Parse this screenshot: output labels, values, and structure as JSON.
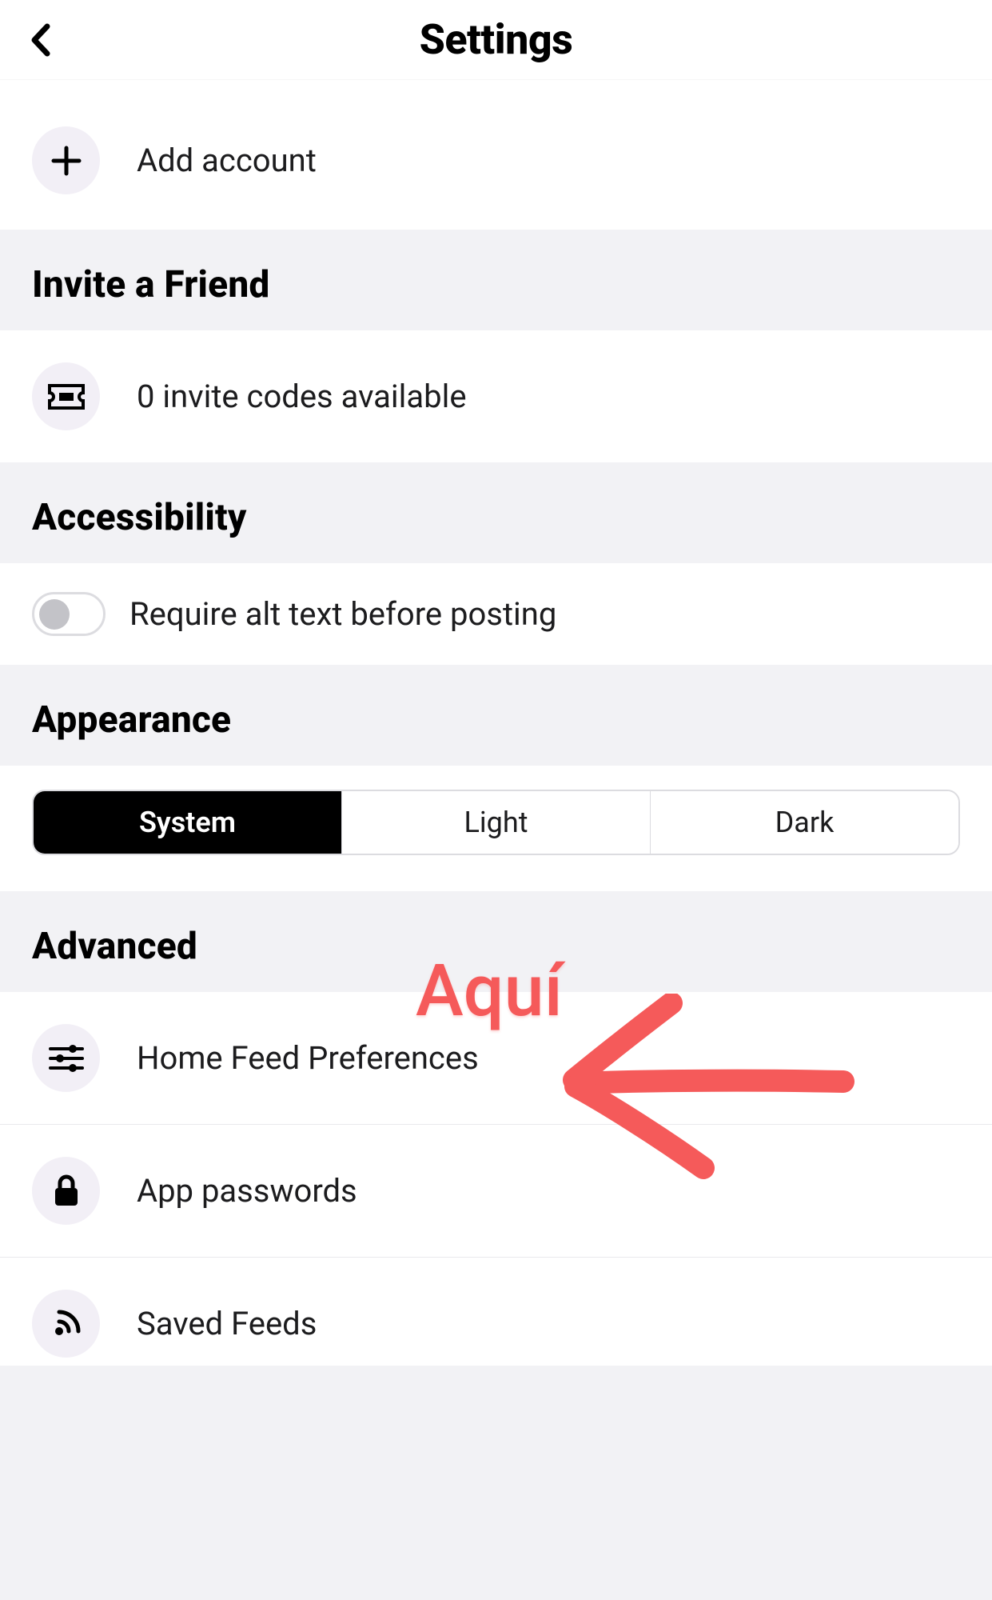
{
  "header": {
    "title": "Settings"
  },
  "accounts": {
    "add_label": "Add account"
  },
  "invite": {
    "header": "Invite a Friend",
    "codes_label": "0 invite codes available"
  },
  "accessibility": {
    "header": "Accessibility",
    "alt_text_label": "Require alt text before posting",
    "alt_text_on": false
  },
  "appearance": {
    "header": "Appearance",
    "options": [
      "System",
      "Light",
      "Dark"
    ],
    "selected": "System"
  },
  "advanced": {
    "header": "Advanced",
    "items": [
      {
        "label": "Home Feed Preferences",
        "icon": "sliders"
      },
      {
        "label": "App passwords",
        "icon": "lock"
      },
      {
        "label": "Saved Feeds",
        "icon": "satellite"
      }
    ]
  },
  "annotation": {
    "text": "Aquí"
  }
}
